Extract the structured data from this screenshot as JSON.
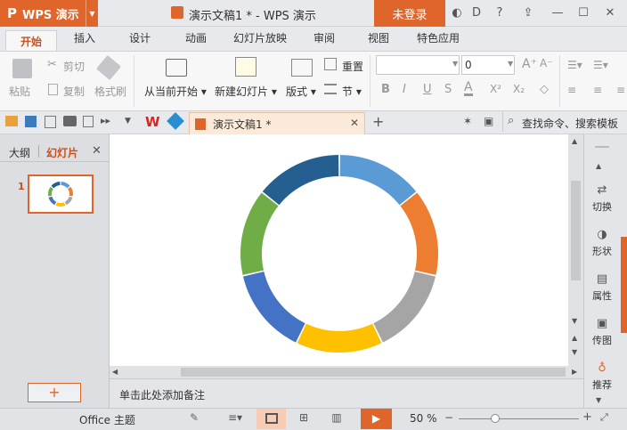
{
  "app": {
    "logo_text": "WPS 演示",
    "doc_title": "演示文稿1 * - WPS 演示",
    "login_label": "未登录"
  },
  "ribbon_tabs": [
    "开始",
    "插入",
    "设计",
    "动画",
    "幻灯片放映",
    "审阅",
    "视图",
    "特色应用"
  ],
  "ribbon": {
    "paste": "粘贴",
    "cut": "剪切",
    "copy": "复制",
    "format_painter": "格式刷",
    "from_current": "从当前开始",
    "new_slide": "新建幻灯片",
    "layout": "版式",
    "reset": "重置",
    "section": "节",
    "font_size_value": "0",
    "bold": "B",
    "italic": "I",
    "underline": "U",
    "font_color": "A",
    "superscript": "X²",
    "subscript": "X₂"
  },
  "quickbar": {
    "doc_tab_label": "演示文稿1 *",
    "search_label": "查找命令、搜索模板"
  },
  "leftpanel": {
    "outline_tab": "大纲",
    "slides_tab": "幻灯片",
    "slide_number": "1",
    "add_button": "+"
  },
  "notes_placeholder": "单击此处添加备注",
  "rightbar": [
    {
      "label": "切换",
      "icon": "transition-icon"
    },
    {
      "label": "形状",
      "icon": "shape-icon"
    },
    {
      "label": "属性",
      "icon": "properties-icon"
    },
    {
      "label": "传图",
      "icon": "image-upload-icon"
    },
    {
      "label": "推荐",
      "icon": "recommend-icon"
    }
  ],
  "status": {
    "theme": "Office 主题",
    "zoom": "50 %",
    "zoom_fraction": 0.3
  },
  "colors": {
    "accent": "#e0652b",
    "donut": [
      "#5b9bd5",
      "#ed7d31",
      "#a5a5a5",
      "#ffc000",
      "#4472c4",
      "#70ad47",
      "#255e91"
    ]
  }
}
